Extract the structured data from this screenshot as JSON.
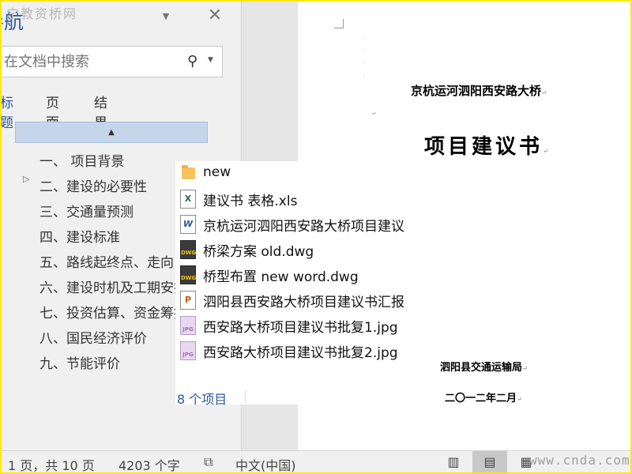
{
  "watermark_top": "宁教资桥网",
  "nav_pane": {
    "title": "导航",
    "search_placeholder": "在文档中搜索",
    "tabs": [
      {
        "label": "标题",
        "active": true
      },
      {
        "label": "页面",
        "active": false
      },
      {
        "label": "结果",
        "active": false
      }
    ],
    "collapse_glyph": "▲",
    "headings": [
      "一、 项目背景",
      "二、建设的必要性",
      "三、交通量预测",
      "四、建设标准",
      "五、路线起终点、走向",
      "六、建设时机及工期安排",
      "七、投资估算、资金筹措",
      "八、国民经济评价",
      "九、节能评价"
    ]
  },
  "document": {
    "subtitle": "京杭运河泗阳西安路大桥",
    "title": "项目建议书",
    "organization": "泗阳县交通运输局",
    "date": "二〇一二年二月",
    "paragraph_mark": "↵"
  },
  "file_popup": {
    "items": [
      {
        "name": "new",
        "icon": "folder-icon"
      },
      {
        "name": "建议书 表格.xls",
        "icon": "excel-icon"
      },
      {
        "name": "京杭运河泗阳西安路大桥项目建议",
        "icon": "word-icon"
      },
      {
        "name": "桥梁方案 old.dwg",
        "icon": "dwg-icon"
      },
      {
        "name": "桥型布置 new word.dwg",
        "icon": "dwg-icon"
      },
      {
        "name": "泗阳县西安路大桥项目建议书汇报",
        "icon": "powerpoint-icon"
      },
      {
        "name": "西安路大桥项目建议书批复1.jpg",
        "icon": "jpg-icon"
      },
      {
        "name": "西安路大桥项目建议书批复2.jpg",
        "icon": "jpg-icon"
      }
    ],
    "count_label": "8 个项目"
  },
  "status_bar": {
    "page_info": "1 页，共 10 页",
    "word_count": "4203 个字",
    "language": "中文(中国)"
  },
  "watermark_bottom": "www.cnda.com",
  "colors": {
    "accent": "#2b579a",
    "frame": "#ffe800",
    "pane_bg": "#f0f0f0"
  }
}
